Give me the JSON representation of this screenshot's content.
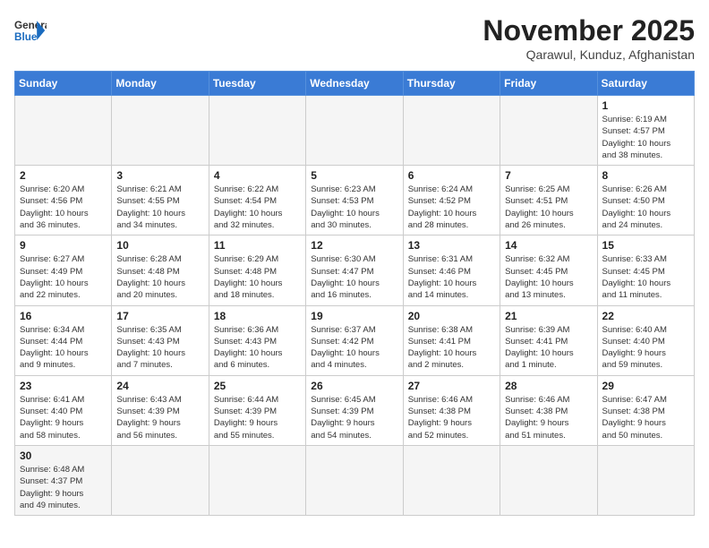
{
  "logo": {
    "text_general": "General",
    "text_blue": "Blue"
  },
  "title": "November 2025",
  "location": "Qarawul, Kunduz, Afghanistan",
  "weekdays": [
    "Sunday",
    "Monday",
    "Tuesday",
    "Wednesday",
    "Thursday",
    "Friday",
    "Saturday"
  ],
  "days": [
    {
      "num": "",
      "info": ""
    },
    {
      "num": "",
      "info": ""
    },
    {
      "num": "",
      "info": ""
    },
    {
      "num": "",
      "info": ""
    },
    {
      "num": "",
      "info": ""
    },
    {
      "num": "",
      "info": ""
    },
    {
      "num": "1",
      "info": "Sunrise: 6:19 AM\nSunset: 4:57 PM\nDaylight: 10 hours\nand 38 minutes."
    },
    {
      "num": "2",
      "info": "Sunrise: 6:20 AM\nSunset: 4:56 PM\nDaylight: 10 hours\nand 36 minutes."
    },
    {
      "num": "3",
      "info": "Sunrise: 6:21 AM\nSunset: 4:55 PM\nDaylight: 10 hours\nand 34 minutes."
    },
    {
      "num": "4",
      "info": "Sunrise: 6:22 AM\nSunset: 4:54 PM\nDaylight: 10 hours\nand 32 minutes."
    },
    {
      "num": "5",
      "info": "Sunrise: 6:23 AM\nSunset: 4:53 PM\nDaylight: 10 hours\nand 30 minutes."
    },
    {
      "num": "6",
      "info": "Sunrise: 6:24 AM\nSunset: 4:52 PM\nDaylight: 10 hours\nand 28 minutes."
    },
    {
      "num": "7",
      "info": "Sunrise: 6:25 AM\nSunset: 4:51 PM\nDaylight: 10 hours\nand 26 minutes."
    },
    {
      "num": "8",
      "info": "Sunrise: 6:26 AM\nSunset: 4:50 PM\nDaylight: 10 hours\nand 24 minutes."
    },
    {
      "num": "9",
      "info": "Sunrise: 6:27 AM\nSunset: 4:49 PM\nDaylight: 10 hours\nand 22 minutes."
    },
    {
      "num": "10",
      "info": "Sunrise: 6:28 AM\nSunset: 4:48 PM\nDaylight: 10 hours\nand 20 minutes."
    },
    {
      "num": "11",
      "info": "Sunrise: 6:29 AM\nSunset: 4:48 PM\nDaylight: 10 hours\nand 18 minutes."
    },
    {
      "num": "12",
      "info": "Sunrise: 6:30 AM\nSunset: 4:47 PM\nDaylight: 10 hours\nand 16 minutes."
    },
    {
      "num": "13",
      "info": "Sunrise: 6:31 AM\nSunset: 4:46 PM\nDaylight: 10 hours\nand 14 minutes."
    },
    {
      "num": "14",
      "info": "Sunrise: 6:32 AM\nSunset: 4:45 PM\nDaylight: 10 hours\nand 13 minutes."
    },
    {
      "num": "15",
      "info": "Sunrise: 6:33 AM\nSunset: 4:45 PM\nDaylight: 10 hours\nand 11 minutes."
    },
    {
      "num": "16",
      "info": "Sunrise: 6:34 AM\nSunset: 4:44 PM\nDaylight: 10 hours\nand 9 minutes."
    },
    {
      "num": "17",
      "info": "Sunrise: 6:35 AM\nSunset: 4:43 PM\nDaylight: 10 hours\nand 7 minutes."
    },
    {
      "num": "18",
      "info": "Sunrise: 6:36 AM\nSunset: 4:43 PM\nDaylight: 10 hours\nand 6 minutes."
    },
    {
      "num": "19",
      "info": "Sunrise: 6:37 AM\nSunset: 4:42 PM\nDaylight: 10 hours\nand 4 minutes."
    },
    {
      "num": "20",
      "info": "Sunrise: 6:38 AM\nSunset: 4:41 PM\nDaylight: 10 hours\nand 2 minutes."
    },
    {
      "num": "21",
      "info": "Sunrise: 6:39 AM\nSunset: 4:41 PM\nDaylight: 10 hours\nand 1 minute."
    },
    {
      "num": "22",
      "info": "Sunrise: 6:40 AM\nSunset: 4:40 PM\nDaylight: 9 hours\nand 59 minutes."
    },
    {
      "num": "23",
      "info": "Sunrise: 6:41 AM\nSunset: 4:40 PM\nDaylight: 9 hours\nand 58 minutes."
    },
    {
      "num": "24",
      "info": "Sunrise: 6:43 AM\nSunset: 4:39 PM\nDaylight: 9 hours\nand 56 minutes."
    },
    {
      "num": "25",
      "info": "Sunrise: 6:44 AM\nSunset: 4:39 PM\nDaylight: 9 hours\nand 55 minutes."
    },
    {
      "num": "26",
      "info": "Sunrise: 6:45 AM\nSunset: 4:39 PM\nDaylight: 9 hours\nand 54 minutes."
    },
    {
      "num": "27",
      "info": "Sunrise: 6:46 AM\nSunset: 4:38 PM\nDaylight: 9 hours\nand 52 minutes."
    },
    {
      "num": "28",
      "info": "Sunrise: 6:46 AM\nSunset: 4:38 PM\nDaylight: 9 hours\nand 51 minutes."
    },
    {
      "num": "29",
      "info": "Sunrise: 6:47 AM\nSunset: 4:38 PM\nDaylight: 9 hours\nand 50 minutes."
    },
    {
      "num": "30",
      "info": "Sunrise: 6:48 AM\nSunset: 4:37 PM\nDaylight: 9 hours\nand 49 minutes."
    },
    {
      "num": "",
      "info": ""
    },
    {
      "num": "",
      "info": ""
    },
    {
      "num": "",
      "info": ""
    },
    {
      "num": "",
      "info": ""
    },
    {
      "num": "",
      "info": ""
    },
    {
      "num": "",
      "info": ""
    }
  ]
}
